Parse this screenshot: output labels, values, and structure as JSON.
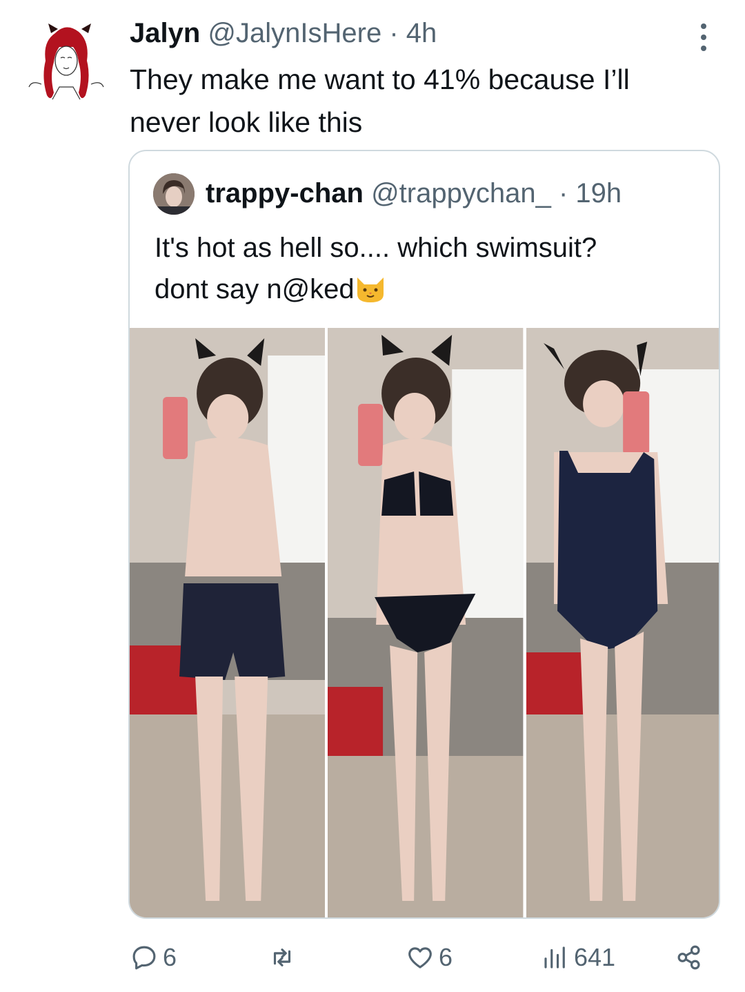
{
  "post": {
    "author_name": "Jalyn",
    "author_handle": "@JalynIsHere",
    "time": "· 4h",
    "text": "They make me want to 41% because I’ll never look like this"
  },
  "quoted": {
    "author_name": "trappy-chan",
    "author_handle": "@trappychan_",
    "time": "· 19h",
    "text_line1": "It's hot as hell so.... which swimsuit?",
    "text_line2": "dont say n@ked",
    "emoji": "cat-face-emoji"
  },
  "photos": [
    {
      "name": "mirror-selfie-shorts",
      "swimsuit": "dark shorts"
    },
    {
      "name": "mirror-selfie-bikini",
      "swimsuit": "black bikini"
    },
    {
      "name": "mirror-selfie-one-piece",
      "swimsuit": "navy one-piece"
    }
  ],
  "actions": {
    "reply_count": "6",
    "repost_count": "",
    "like_count": "6",
    "views_count": "641"
  },
  "colors": {
    "text_primary": "#0f1419",
    "text_secondary": "#536471",
    "border": "#cfd9de",
    "avatar_hair": "#b3121f"
  }
}
